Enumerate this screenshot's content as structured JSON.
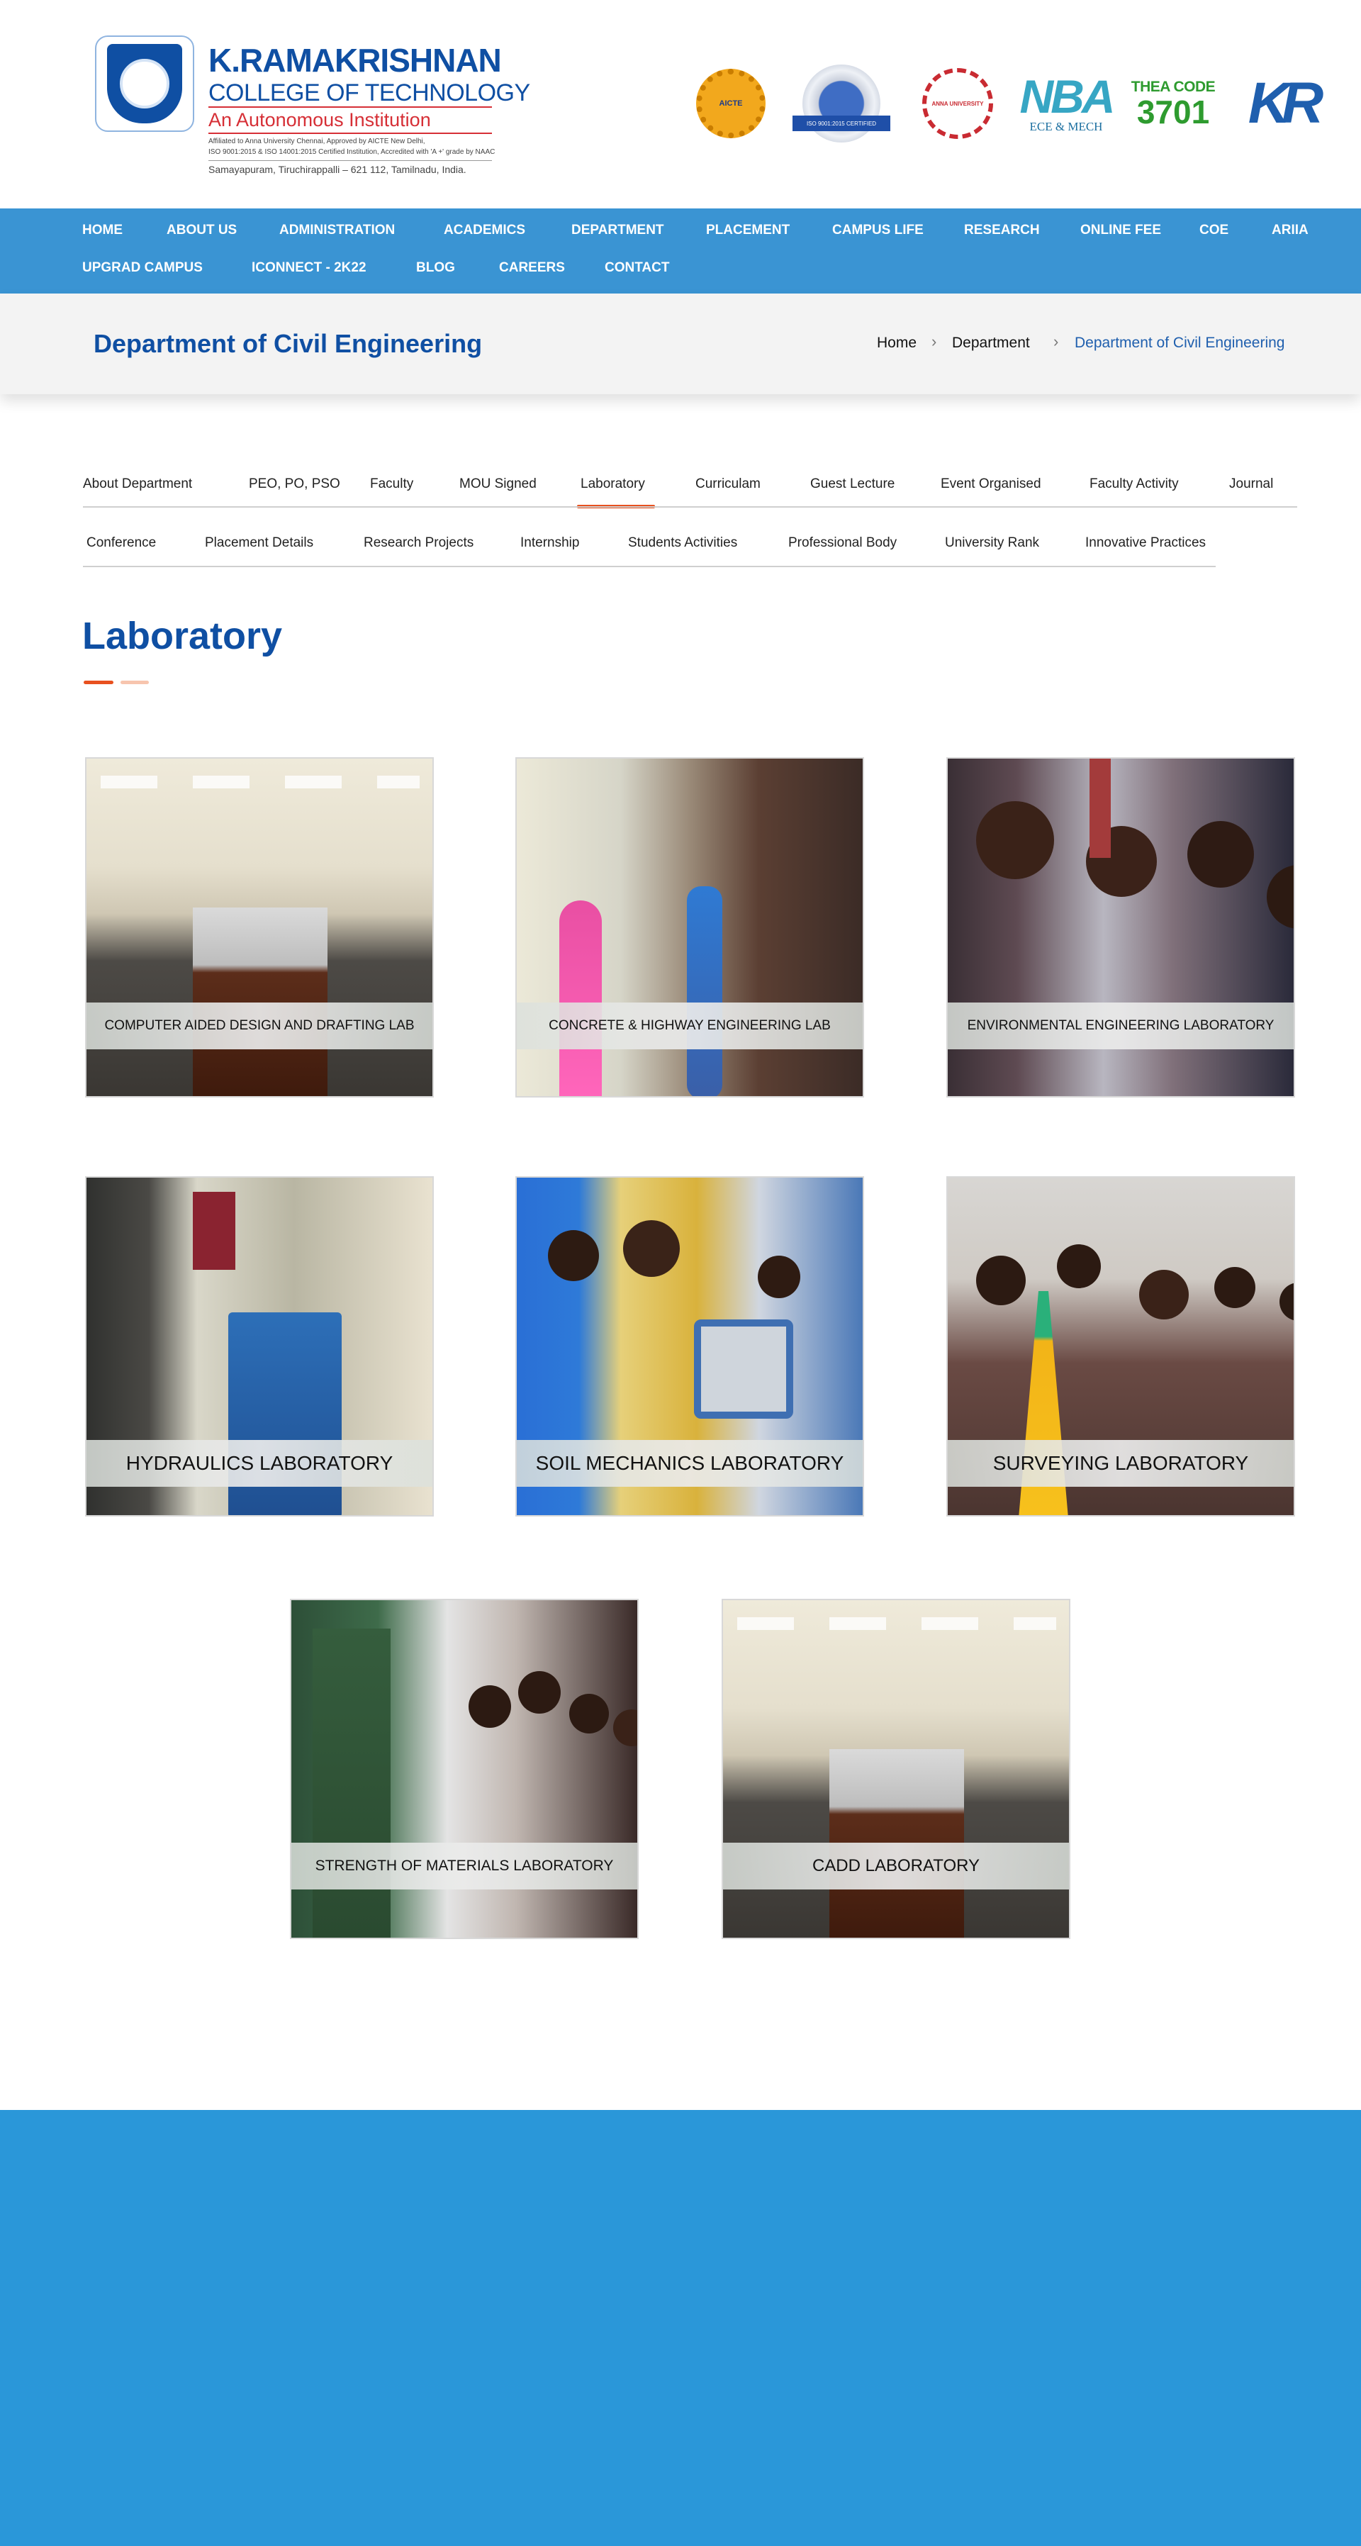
{
  "header": {
    "logo": {
      "name": "K.RAMAKRISHNAN",
      "subtitle": "COLLEGE OF TECHNOLOGY",
      "autonomous": "An Autonomous Institution",
      "affiliation_line1": "Affiliated to Anna University Chennai, Approved by AICTE New Delhi,",
      "affiliation_line2": "ISO 9001:2015 & ISO 14001:2015 Certified Institution, Accredited with 'A +' grade by NAAC",
      "address": "Samayapuram, Tiruchirappalli – 621 112, Tamilnadu, India."
    },
    "accreditations": {
      "aicte": "AICTE",
      "iso_ribbon": "ISO 9001:2015 CERTIFIED",
      "au": "ANNA UNIVERSITY",
      "nba": "NBA",
      "nba_sub": "ECE & MECH",
      "thea_label": "THEA CODE",
      "thea_code": "3701",
      "kr": "KR"
    }
  },
  "nav": {
    "row1": [
      "HOME",
      "ABOUT US",
      "ADMINISTRATION",
      "ACADEMICS",
      "DEPARTMENT",
      "PLACEMENT",
      "CAMPUS LIFE",
      "RESEARCH",
      "ONLINE FEE",
      "COE",
      "ARIIA"
    ],
    "row2": [
      "UPGRAD CAMPUS",
      "ICONNECT - 2K22",
      "BLOG",
      "CAREERS",
      "CONTACT"
    ]
  },
  "title_bar": {
    "title": "Department of Civil Engineering",
    "breadcrumb": [
      "Home",
      "Department",
      "Department of Civil Engineering"
    ]
  },
  "tabs": {
    "row1": [
      "About Department",
      "PEO, PO, PSO",
      "Faculty",
      "MOU Signed",
      "Laboratory",
      "Curriculam",
      "Guest Lecture",
      "Event Organised",
      "Faculty Activity",
      "Journal"
    ],
    "row2": [
      "Conference",
      "Placement Details",
      "Research Projects",
      "Internship",
      "Students Activities",
      "Professional Body",
      "University Rank",
      "Innovative Practices"
    ],
    "active": "Laboratory"
  },
  "section": {
    "heading": "Laboratory"
  },
  "labs": [
    "COMPUTER AIDED DESIGN AND DRAFTING LAB",
    "CONCRETE & HIGHWAY ENGINEERING LAB",
    "ENVIRONMENTAL ENGINEERING LABORATORY",
    "HYDRAULICS LABORATORY",
    "SOIL MECHANICS LABORATORY",
    "SURVEYING LABORATORY",
    "STRENGTH OF MATERIALS LABORATORY",
    "CADD LABORATORY"
  ],
  "colors": {
    "brand_blue": "#0f4fa3",
    "nav_blue": "#3a94d3",
    "accent_orange": "#e8511f",
    "footer_blue": "#2a97d9"
  }
}
